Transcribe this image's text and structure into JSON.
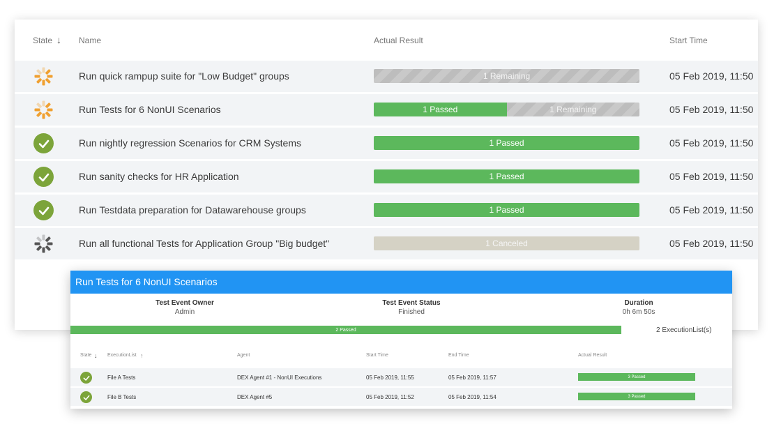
{
  "colors": {
    "passed": "#5cb85c",
    "remaining": "#bdbdbd",
    "canceled": "#d5d2c5",
    "check": "#7ca43a",
    "running": "#f0a030",
    "header": "#2194f3"
  },
  "table": {
    "headers": {
      "state": "State",
      "name": "Name",
      "actual_result": "Actual Result",
      "start_time": "Start Time"
    },
    "sort_icon": "arrow-down-icon",
    "rows": [
      {
        "state": "in-progress",
        "icon": "in-progress-icon",
        "name": "Run quick rampup suite for \"Low Budget\" groups",
        "result": [
          {
            "type": "remaining",
            "label": "1 Remaining",
            "fraction": 1.0
          }
        ],
        "start_time": "05 Feb 2019, 11:50"
      },
      {
        "state": "in-progress",
        "icon": "in-progress-icon",
        "name": "Run Tests for 6 NonUI Scenarios",
        "result": [
          {
            "type": "passed",
            "label": "1 Passed",
            "fraction": 0.5
          },
          {
            "type": "remaining",
            "label": "1 Remaining",
            "fraction": 0.5
          }
        ],
        "start_time": "05 Feb 2019, 11:50"
      },
      {
        "state": "passed",
        "icon": "checkmark-icon",
        "name": "Run nightly regression Scenarios for CRM Systems",
        "result": [
          {
            "type": "passed",
            "label": "1 Passed",
            "fraction": 1.0
          }
        ],
        "start_time": "05 Feb 2019, 11:50"
      },
      {
        "state": "passed",
        "icon": "checkmark-icon",
        "name": "Run sanity checks for HR Application",
        "result": [
          {
            "type": "passed",
            "label": "1 Passed",
            "fraction": 1.0
          }
        ],
        "start_time": "05 Feb 2019, 11:50"
      },
      {
        "state": "passed",
        "icon": "checkmark-icon",
        "name": "Run Testdata preparation for Datawarehouse groups",
        "result": [
          {
            "type": "passed",
            "label": "1 Passed",
            "fraction": 1.0
          }
        ],
        "start_time": "05 Feb 2019, 11:50"
      },
      {
        "state": "canceled",
        "icon": "canceled-icon",
        "name": "Run all functional Tests for Application Group \"Big budget\"",
        "result": [
          {
            "type": "canceled",
            "label": "1 Canceled",
            "fraction": 1.0
          }
        ],
        "start_time": "05 Feb 2019, 11:50"
      }
    ]
  },
  "detail": {
    "title": "Run Tests for 6 NonUI Scenarios",
    "owner_label": "Test Event Owner",
    "owner_value": "Admin",
    "status_label": "Test Event Status",
    "status_value": "Finished",
    "duration_label": "Duration",
    "duration_value": "0h 6m 50s",
    "progress_label": "2 Passed",
    "progress_fraction": 1.0,
    "execution_count": "2 ExecutionList(s)",
    "headers": {
      "state": "State",
      "execution_list": "ExecutionList",
      "agent": "Agent",
      "start_time": "Start Time",
      "end_time": "End Time",
      "actual_result": "Actual Result"
    },
    "rows": [
      {
        "icon": "checkmark-icon",
        "execution_list": "File A Tests",
        "agent": "DEX Agent #1 - NonUI Executions",
        "start_time": "05 Feb 2019, 11:55",
        "end_time": "05 Feb 2019, 11:57",
        "result": "3 Passed"
      },
      {
        "icon": "checkmark-icon",
        "execution_list": "File B Tests",
        "agent": "DEX Agent #5",
        "start_time": "05 Feb 2019, 11:52",
        "end_time": "05 Feb 2019, 11:54",
        "result": "3 Passed"
      }
    ]
  }
}
